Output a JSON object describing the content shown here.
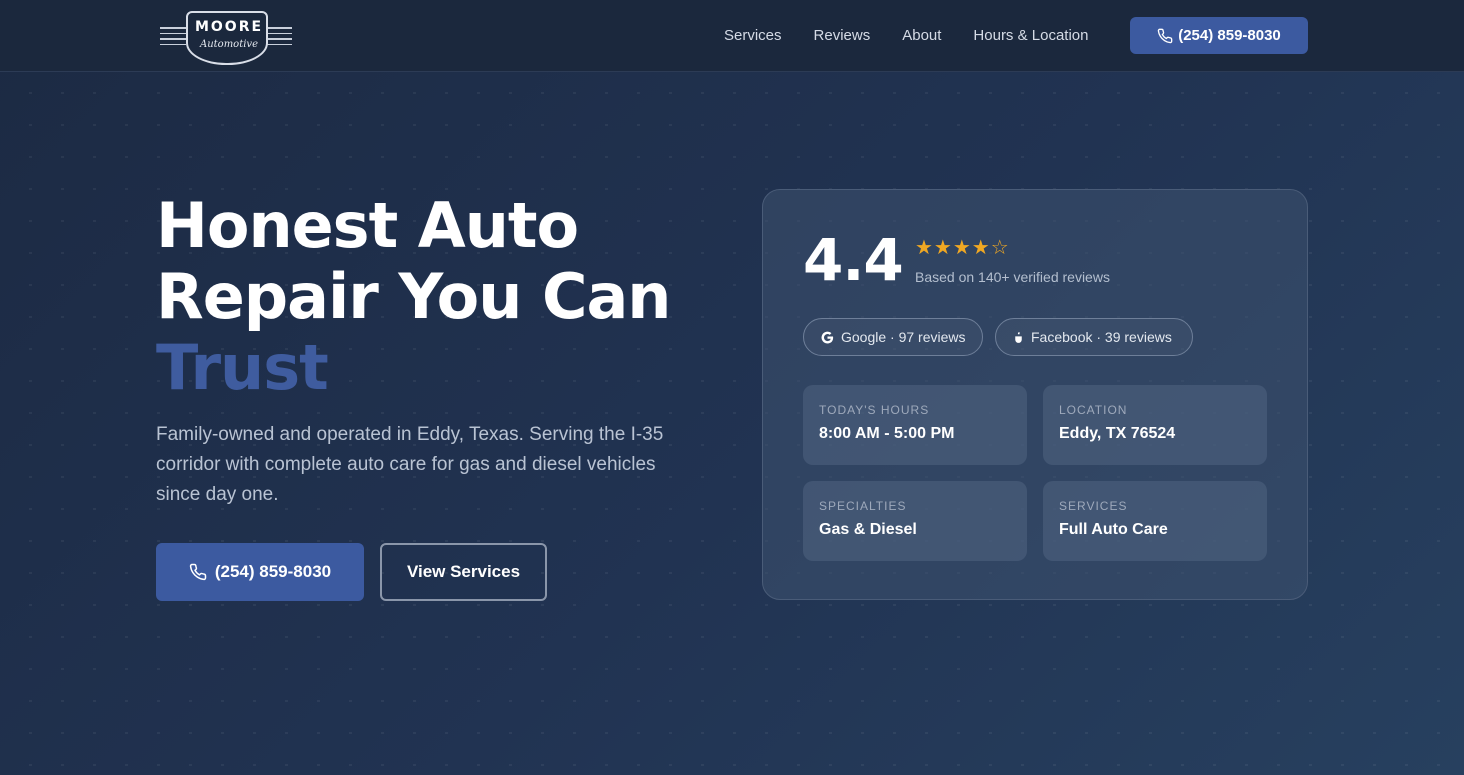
{
  "brand": {
    "name": "MOORE",
    "subname": "Automotive"
  },
  "nav": {
    "items": [
      {
        "label": "Services"
      },
      {
        "label": "Reviews"
      },
      {
        "label": "About"
      },
      {
        "label": "Hours & Location"
      }
    ],
    "cta_label": "(254) 859-8030"
  },
  "hero": {
    "title_line1": "Honest Auto",
    "title_line2": "Repair You Can",
    "title_accent": "Trust",
    "subtitle": "Family-owned and operated in Eddy, Texas. Serving the I-35 corridor with complete auto care for gas and diesel vehicles since day one.",
    "primary_button": "(254) 859-8030",
    "secondary_button": "View Services"
  },
  "card": {
    "rating": "4.4",
    "stars": {
      "full": "★★★★",
      "empty": "☆",
      "value": 4.4,
      "max": 5
    },
    "based_on": "Based on 140+ verified reviews",
    "sources": [
      {
        "label": "Google · 97 reviews",
        "icon": "google-icon"
      },
      {
        "label": "Facebook · 39 reviews",
        "icon": "facebook-icon"
      }
    ],
    "tiles": [
      {
        "label": "TODAY'S HOURS",
        "value": "8:00 AM - 5:00 PM"
      },
      {
        "label": "LOCATION",
        "value": "Eddy, TX 76524"
      },
      {
        "label": "SPECIALTIES",
        "value": "Gas & Diesel"
      },
      {
        "label": "SERVICES",
        "value": "Full Auto Care"
      }
    ]
  },
  "colors": {
    "header_bg": "#1b283d",
    "accent": "#3c5aa0",
    "accent_text": "#3f5c9f",
    "star": "#f0a823"
  }
}
